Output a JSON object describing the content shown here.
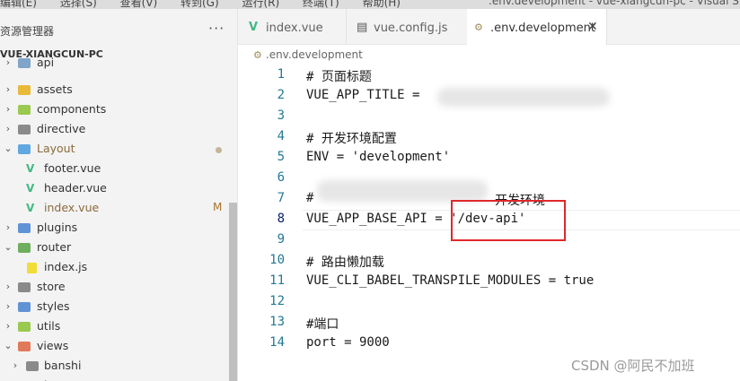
{
  "window": {
    "menu": [
      "编辑(E)",
      "选择(S)",
      "查看(V)",
      "转到(G)",
      "运行(R)",
      "终端(T)",
      "帮助(H)"
    ],
    "title": ".env.development - vue-xiangcun-pc - Visual Studio C"
  },
  "sidebar": {
    "header": "资源管理器",
    "more": "···",
    "project": "VUE-XIANGCUN-PC",
    "items": [
      {
        "label": "api",
        "type": "folder"
      },
      {
        "label": "assets",
        "type": "folder"
      },
      {
        "label": "components",
        "type": "folder"
      },
      {
        "label": "directive",
        "type": "folder"
      },
      {
        "label": "Layout",
        "type": "folder-open"
      },
      {
        "label": "footer.vue",
        "type": "vue"
      },
      {
        "label": "header.vue",
        "type": "vue"
      },
      {
        "label": "index.vue",
        "type": "vue",
        "badge": "M"
      },
      {
        "label": "plugins",
        "type": "folder"
      },
      {
        "label": "router",
        "type": "folder-open"
      },
      {
        "label": "index.js",
        "type": "js"
      },
      {
        "label": "store",
        "type": "folder"
      },
      {
        "label": "styles",
        "type": "folder"
      },
      {
        "label": "utils",
        "type": "folder"
      },
      {
        "label": "views",
        "type": "folder-open"
      },
      {
        "label": "banshi",
        "type": "folder"
      },
      {
        "label": "home",
        "type": "folder"
      }
    ]
  },
  "tabs": [
    {
      "label": "index.vue",
      "icon": "vue-icon"
    },
    {
      "label": "vue.config.js",
      "icon": "js-config-icon"
    },
    {
      "label": ".env.development",
      "icon": "settings-file-icon",
      "active": true
    }
  ],
  "breadcrumb": ".env.development",
  "code": {
    "line_numbers": [
      "1",
      "2",
      "3",
      "4",
      "5",
      "6",
      "7",
      "8",
      "9",
      "10",
      "11",
      "12",
      "13",
      "14"
    ],
    "lines": [
      "# 页面标题",
      "VUE_APP_TITLE = ",
      "",
      "# 开发环境配置",
      "ENV = 'development'",
      "",
      "#",
      "VUE_APP_BASE_API = '/dev-api'",
      "",
      "# 路由懒加载",
      "VUE_CLI_BABEL_TRANSPILE_MODULES = true",
      "",
      "#端口",
      "port = 9000"
    ],
    "line7_suffix": "开发环境",
    "current_line": 8
  },
  "watermark": "CSDN @阿民不加班"
}
